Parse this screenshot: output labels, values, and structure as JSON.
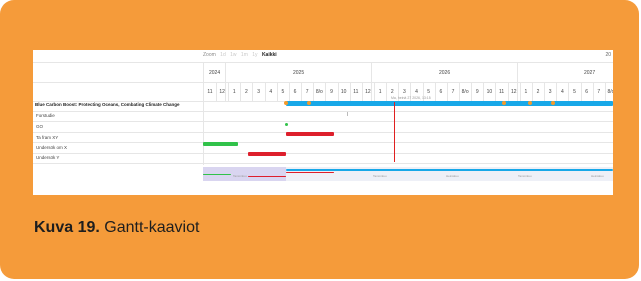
{
  "gantt": {
    "zoom_label": "Zoom",
    "zoom_options": [
      "1d",
      "1w",
      "1m",
      "1y"
    ],
    "zoom_active": "Kaikki",
    "corner_text": "20",
    "years": [
      "2024",
      "2025",
      "2026",
      "2027"
    ],
    "months": [
      "11",
      "12",
      "1",
      "2",
      "3",
      "4",
      "5",
      "6",
      "7",
      "8/o",
      "9",
      "10",
      "11",
      "12",
      "1",
      "2",
      "3",
      "4",
      "5",
      "6",
      "7",
      "8/o",
      "9",
      "10",
      "11",
      "12",
      "1",
      "2",
      "3",
      "4",
      "5",
      "6",
      "7",
      "8/o"
    ],
    "today_label": "Ma, heinä 27 2026, 13:15",
    "tasks": [
      {
        "label": "Blue Carbon Boost: Protecting Oceans, Combating Climate Change",
        "group": true
      },
      {
        "label": "Forstudie",
        "group": false
      },
      {
        "label": "GO",
        "group": false
      },
      {
        "label": "Ta fram XY",
        "group": false
      },
      {
        "label": "Undersök om X",
        "group": false
      },
      {
        "label": "Undersök Y",
        "group": false
      }
    ],
    "mini_labels": [
      "Tammikuu",
      "Tammikuu",
      "Heinäkuu",
      "Tammikuu",
      "Heinäkuu"
    ],
    "colors": {
      "project": "#18a8e8",
      "milestone": "#f39a2c",
      "red": "#dd1f2c",
      "green": "#31c24a",
      "today": "#e02020"
    }
  },
  "caption": {
    "label": "Kuva 19.",
    "text": "Gantt-kaaviot"
  }
}
